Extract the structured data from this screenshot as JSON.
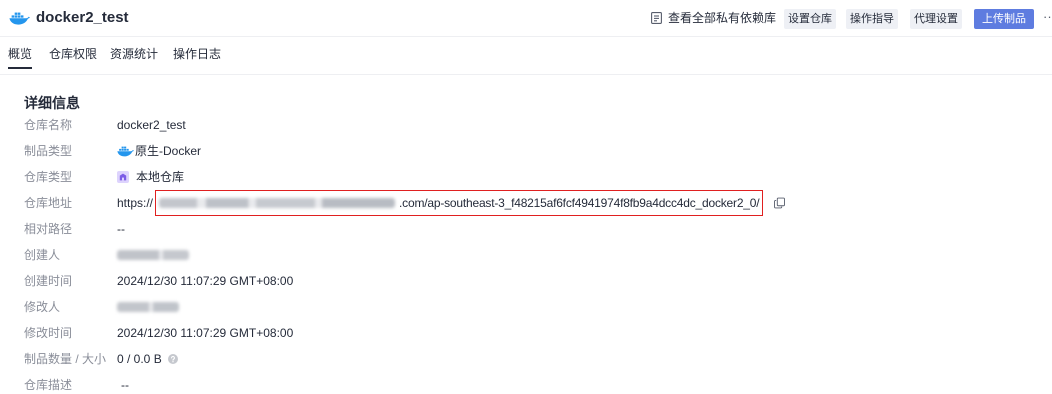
{
  "header": {
    "title_icon": "docker-icon",
    "title": "docker2_test",
    "view_all_icon": "document-icon",
    "view_all_label": "查看全部私有依赖库",
    "buttons": [
      {
        "label": "设置仓库"
      },
      {
        "label": "操作指导"
      },
      {
        "label": "代理设置"
      },
      {
        "label": "上传制品",
        "primary": true
      }
    ],
    "more_label": "··"
  },
  "tabs": [
    {
      "label": "概览",
      "active": true
    },
    {
      "label": "仓库权限"
    },
    {
      "label": "资源统计"
    },
    {
      "label": "操作日志"
    }
  ],
  "details": {
    "section_title": "详细信息",
    "rows": [
      {
        "label": "仓库名称",
        "value": "docker2_test"
      },
      {
        "label": "制品类型",
        "value": "原生-Docker",
        "icon": "docker-icon"
      },
      {
        "label": "仓库类型",
        "value": "本地仓库",
        "icon": "repository-icon"
      },
      {
        "label": "仓库地址",
        "url_prefix": "https://",
        "url_suffix": ".com/ap-southeast-3_f48215af6fcf4941974f8fb9a4dcc4dc_docker2_0/",
        "icon": "copy-icon"
      },
      {
        "label": "相对路径",
        "value": "--"
      },
      {
        "label": "创建人"
      },
      {
        "label": "创建时间",
        "value": "2024/12/30 11:07:29 GMT+08:00"
      },
      {
        "label": "修改人"
      },
      {
        "label": "修改时间",
        "value": "2024/12/30 11:07:29 GMT+08:00"
      },
      {
        "label": "制品数量 / 大小",
        "value": "0 / 0.0 B",
        "icon": "info-icon"
      },
      {
        "label": "仓库描述",
        "value": "--"
      }
    ]
  },
  "colors": {
    "primary": "#5e7ce0",
    "text": "#252b3a",
    "label": "#8a8e99",
    "highlight": "#e02020",
    "docker": "#2496ed",
    "repository": "#7c5ce6",
    "button_bg": "#eef0f5"
  }
}
